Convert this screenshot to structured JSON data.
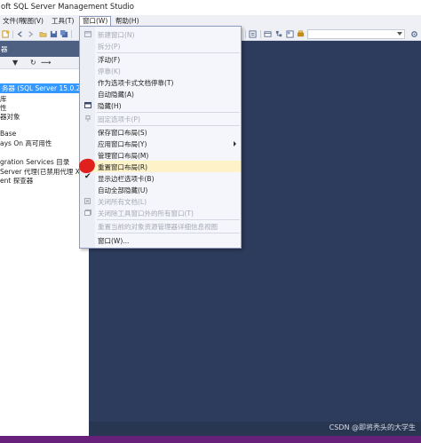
{
  "window": {
    "title": "oft SQL Server Management Studio"
  },
  "menubar": {
    "items": [
      {
        "label": "文件(F)"
      },
      {
        "label": "视图(V)"
      },
      {
        "label": "工具(T)"
      },
      {
        "label": "窗口(W)"
      },
      {
        "label": "帮助(H)"
      }
    ]
  },
  "toolbar": {
    "left_icons": [
      "new-query-icon",
      "back-icon",
      "forward-icon",
      "open-icon",
      "save-icon",
      "save-all-icon"
    ],
    "right_icons": [
      "properties-icon",
      "registered-servers-icon",
      "object-explorer-icon",
      "template-icon",
      "toolbox-icon",
      "options-icon"
    ],
    "combo_value": ""
  },
  "explorer": {
    "header_left": "器",
    "header_right": "中",
    "tool_glyphs": [
      "▼",
      "↻",
      "⟿"
    ],
    "tree": [
      {
        "text": "务器 (SQL Server 15.0.2000",
        "selected": true
      },
      {
        "text": "库"
      },
      {
        "text": "性"
      },
      {
        "text": "器对象"
      },
      {
        "text": ""
      },
      {
        "text": "Base"
      },
      {
        "text": "ays On 高可用性"
      },
      {
        "text": ""
      },
      {
        "text": "gration Services 目录"
      },
      {
        "text": "Server 代理(已禁用代理 XP"
      },
      {
        "text": "ent 探查器"
      }
    ]
  },
  "window_menu": {
    "items": [
      {
        "label": "新建窗口(N)",
        "disabled": true,
        "icon": "new-window-icon"
      },
      {
        "label": "拆分(P)",
        "disabled": true
      },
      {
        "separator": true
      },
      {
        "label": "浮动(F)"
      },
      {
        "label": "停靠(K)",
        "disabled": true
      },
      {
        "label": "作为选项卡式文档停靠(T)"
      },
      {
        "label": "自动隐藏(A)"
      },
      {
        "label": "隐藏(H)",
        "icon": "hide-icon"
      },
      {
        "separator": true
      },
      {
        "label": "固定选项卡(P)",
        "disabled": true,
        "icon": "pin-icon"
      },
      {
        "separator": true
      },
      {
        "label": "保存窗口布局(S)"
      },
      {
        "label": "应用窗口布局(Y)",
        "submenu": true
      },
      {
        "label": "管理窗口布局(M)"
      },
      {
        "label": "重置窗口布局(R)",
        "highlighted": true
      },
      {
        "label": "显示边栏选项卡(B)",
        "checked": true
      },
      {
        "label": "自动全部隐藏(U)"
      },
      {
        "label": "关闭所有文档(L)",
        "disabled": true,
        "icon": "close-all-docs-icon"
      },
      {
        "label": "关闭除工具窗口外的所有窗口(T)",
        "disabled": true,
        "icon": "close-all-windows-icon"
      },
      {
        "separator": true
      },
      {
        "label": "重置当前的对象资源管理器详细信息视图",
        "disabled": true
      },
      {
        "separator": true
      },
      {
        "label": "窗口(W)..."
      }
    ]
  },
  "watermark": "CSDN @即将秃头的大学生",
  "colors": {
    "doc_background": "#2d3b5c",
    "menu_highlight": "#fdf2c8",
    "status_bar": "#68217a",
    "explorer_header": "#4d6082",
    "selection": "#3399ff"
  }
}
